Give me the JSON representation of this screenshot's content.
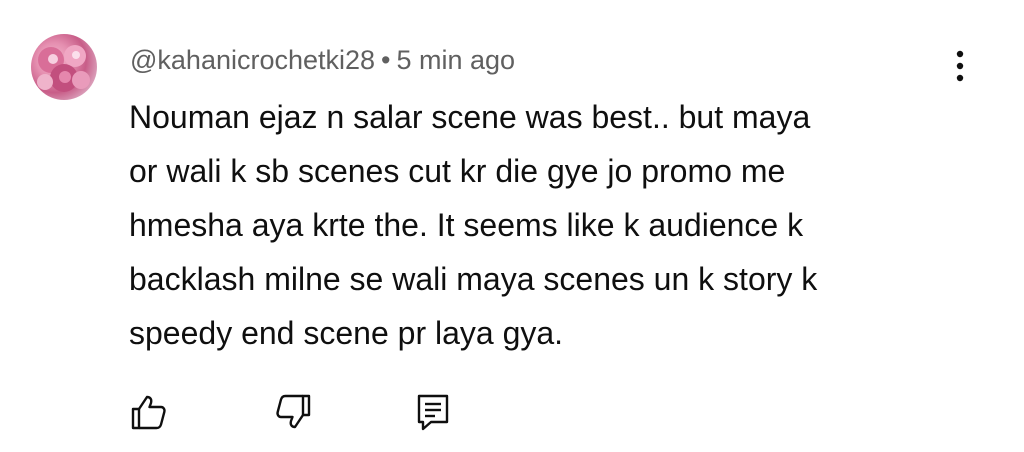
{
  "comment": {
    "author": "@kahanicrochetki28",
    "separator": "•",
    "time": "5 min ago",
    "text_lines": [
      "Nouman ejaz n salar scene was best.. but maya",
      "or wali k sb scenes cut kr die gye jo promo me",
      "hmesha aya krte the. It seems like k audience k",
      "backlash milne se wali maya scenes un k story k",
      "speedy end scene pr laya gya."
    ]
  },
  "icons": {
    "avatar": "avatar-image",
    "more": "more-vert-icon",
    "like": "thumbs-up-icon",
    "dislike": "thumbs-down-icon",
    "reply": "reply-comment-icon"
  },
  "colors": {
    "text": "#0f0f0f",
    "meta": "#606060",
    "icon": "#0f0f0f"
  }
}
